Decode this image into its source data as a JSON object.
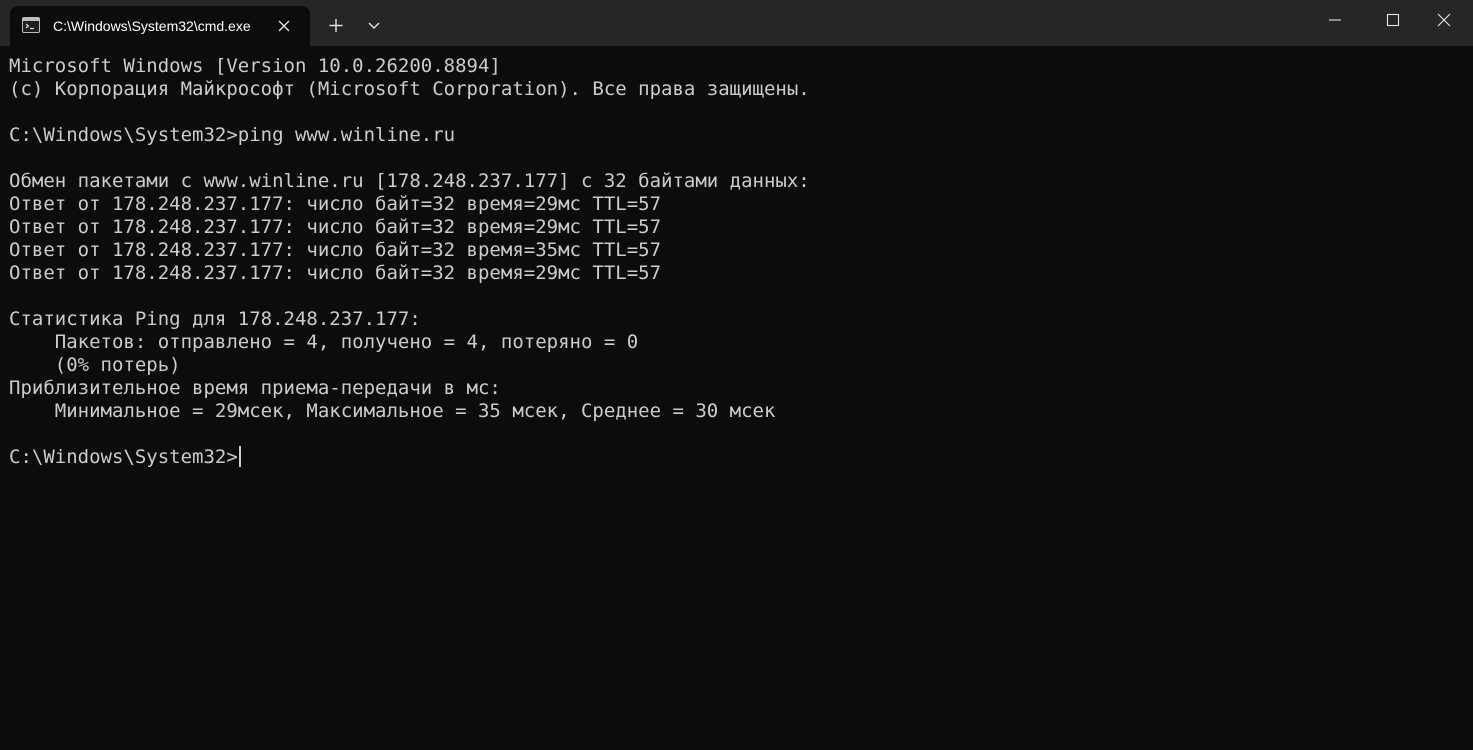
{
  "tab": {
    "title": "C:\\Windows\\System32\\cmd.exe",
    "icon": "cmd-icon"
  },
  "titlebar": {
    "new_tab_icon": "plus-icon",
    "dropdown_icon": "chevron-down-icon",
    "minimize_icon": "minimize-icon",
    "maximize_icon": "maximize-icon",
    "close_icon": "close-icon"
  },
  "console": {
    "lines": [
      "Microsoft Windows [Version 10.0.26200.8894]",
      "(c) Корпорация Майкрософт (Microsoft Corporation). Все права защищены.",
      "",
      "C:\\Windows\\System32>ping www.winline.ru",
      "",
      "Обмен пакетами с www.winline.ru [178.248.237.177] с 32 байтами данных:",
      "Ответ от 178.248.237.177: число байт=32 время=29мс TTL=57",
      "Ответ от 178.248.237.177: число байт=32 время=29мс TTL=57",
      "Ответ от 178.248.237.177: число байт=32 время=35мс TTL=57",
      "Ответ от 178.248.237.177: число байт=32 время=29мс TTL=57",
      "",
      "Статистика Ping для 178.248.237.177:",
      "    Пакетов: отправлено = 4, получено = 4, потеряно = 0",
      "    (0% потерь)",
      "Приблизительное время приема-передачи в мс:",
      "    Минимальное = 29мсек, Максимальное = 35 мсек, Среднее = 30 мсек",
      ""
    ],
    "prompt": "C:\\Windows\\System32>"
  },
  "colors": {
    "background": "#0c0c0c",
    "titlebar": "#262626",
    "text": "#cccccc"
  }
}
